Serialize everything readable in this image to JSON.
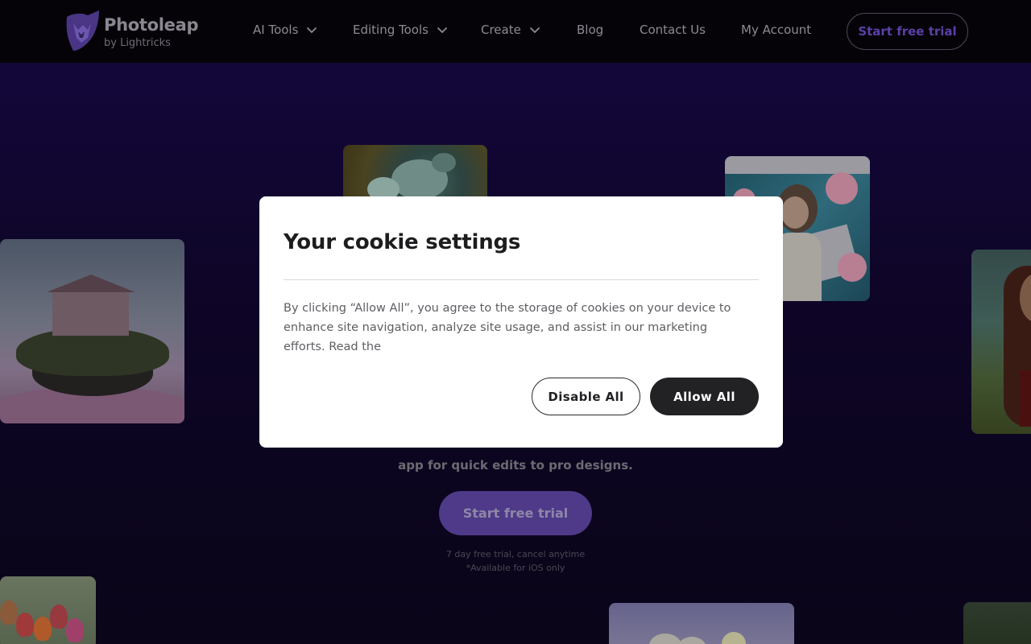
{
  "brand": {
    "name": "Photoleap",
    "tagline": "by Lightricks",
    "accent": "#5a40a8"
  },
  "nav": {
    "items": [
      {
        "label": "AI Tools",
        "has_dropdown": true
      },
      {
        "label": "Editing Tools",
        "has_dropdown": true
      },
      {
        "label": "Create",
        "has_dropdown": true
      },
      {
        "label": "Blog",
        "has_dropdown": false
      },
      {
        "label": "Contact Us",
        "has_dropdown": false
      },
      {
        "label": "My Account",
        "has_dropdown": false
      }
    ],
    "cta_label": "Start free trial"
  },
  "hero": {
    "subtitle_line2": "app for quick edits to pro designs.",
    "cta_label": "Start free trial",
    "note_line1": "7 day free trial, cancel anytime",
    "note_line2": "*Available for iOS only"
  },
  "cookie_modal": {
    "title": "Your cookie settings",
    "body": "By clicking “Allow All”, you agree to the storage of cookies on your device to enhance site navigation, analyze site usage, and assist in our marketing efforts. Read the",
    "disable_label": "Disable All",
    "allow_label": "Allow All"
  }
}
